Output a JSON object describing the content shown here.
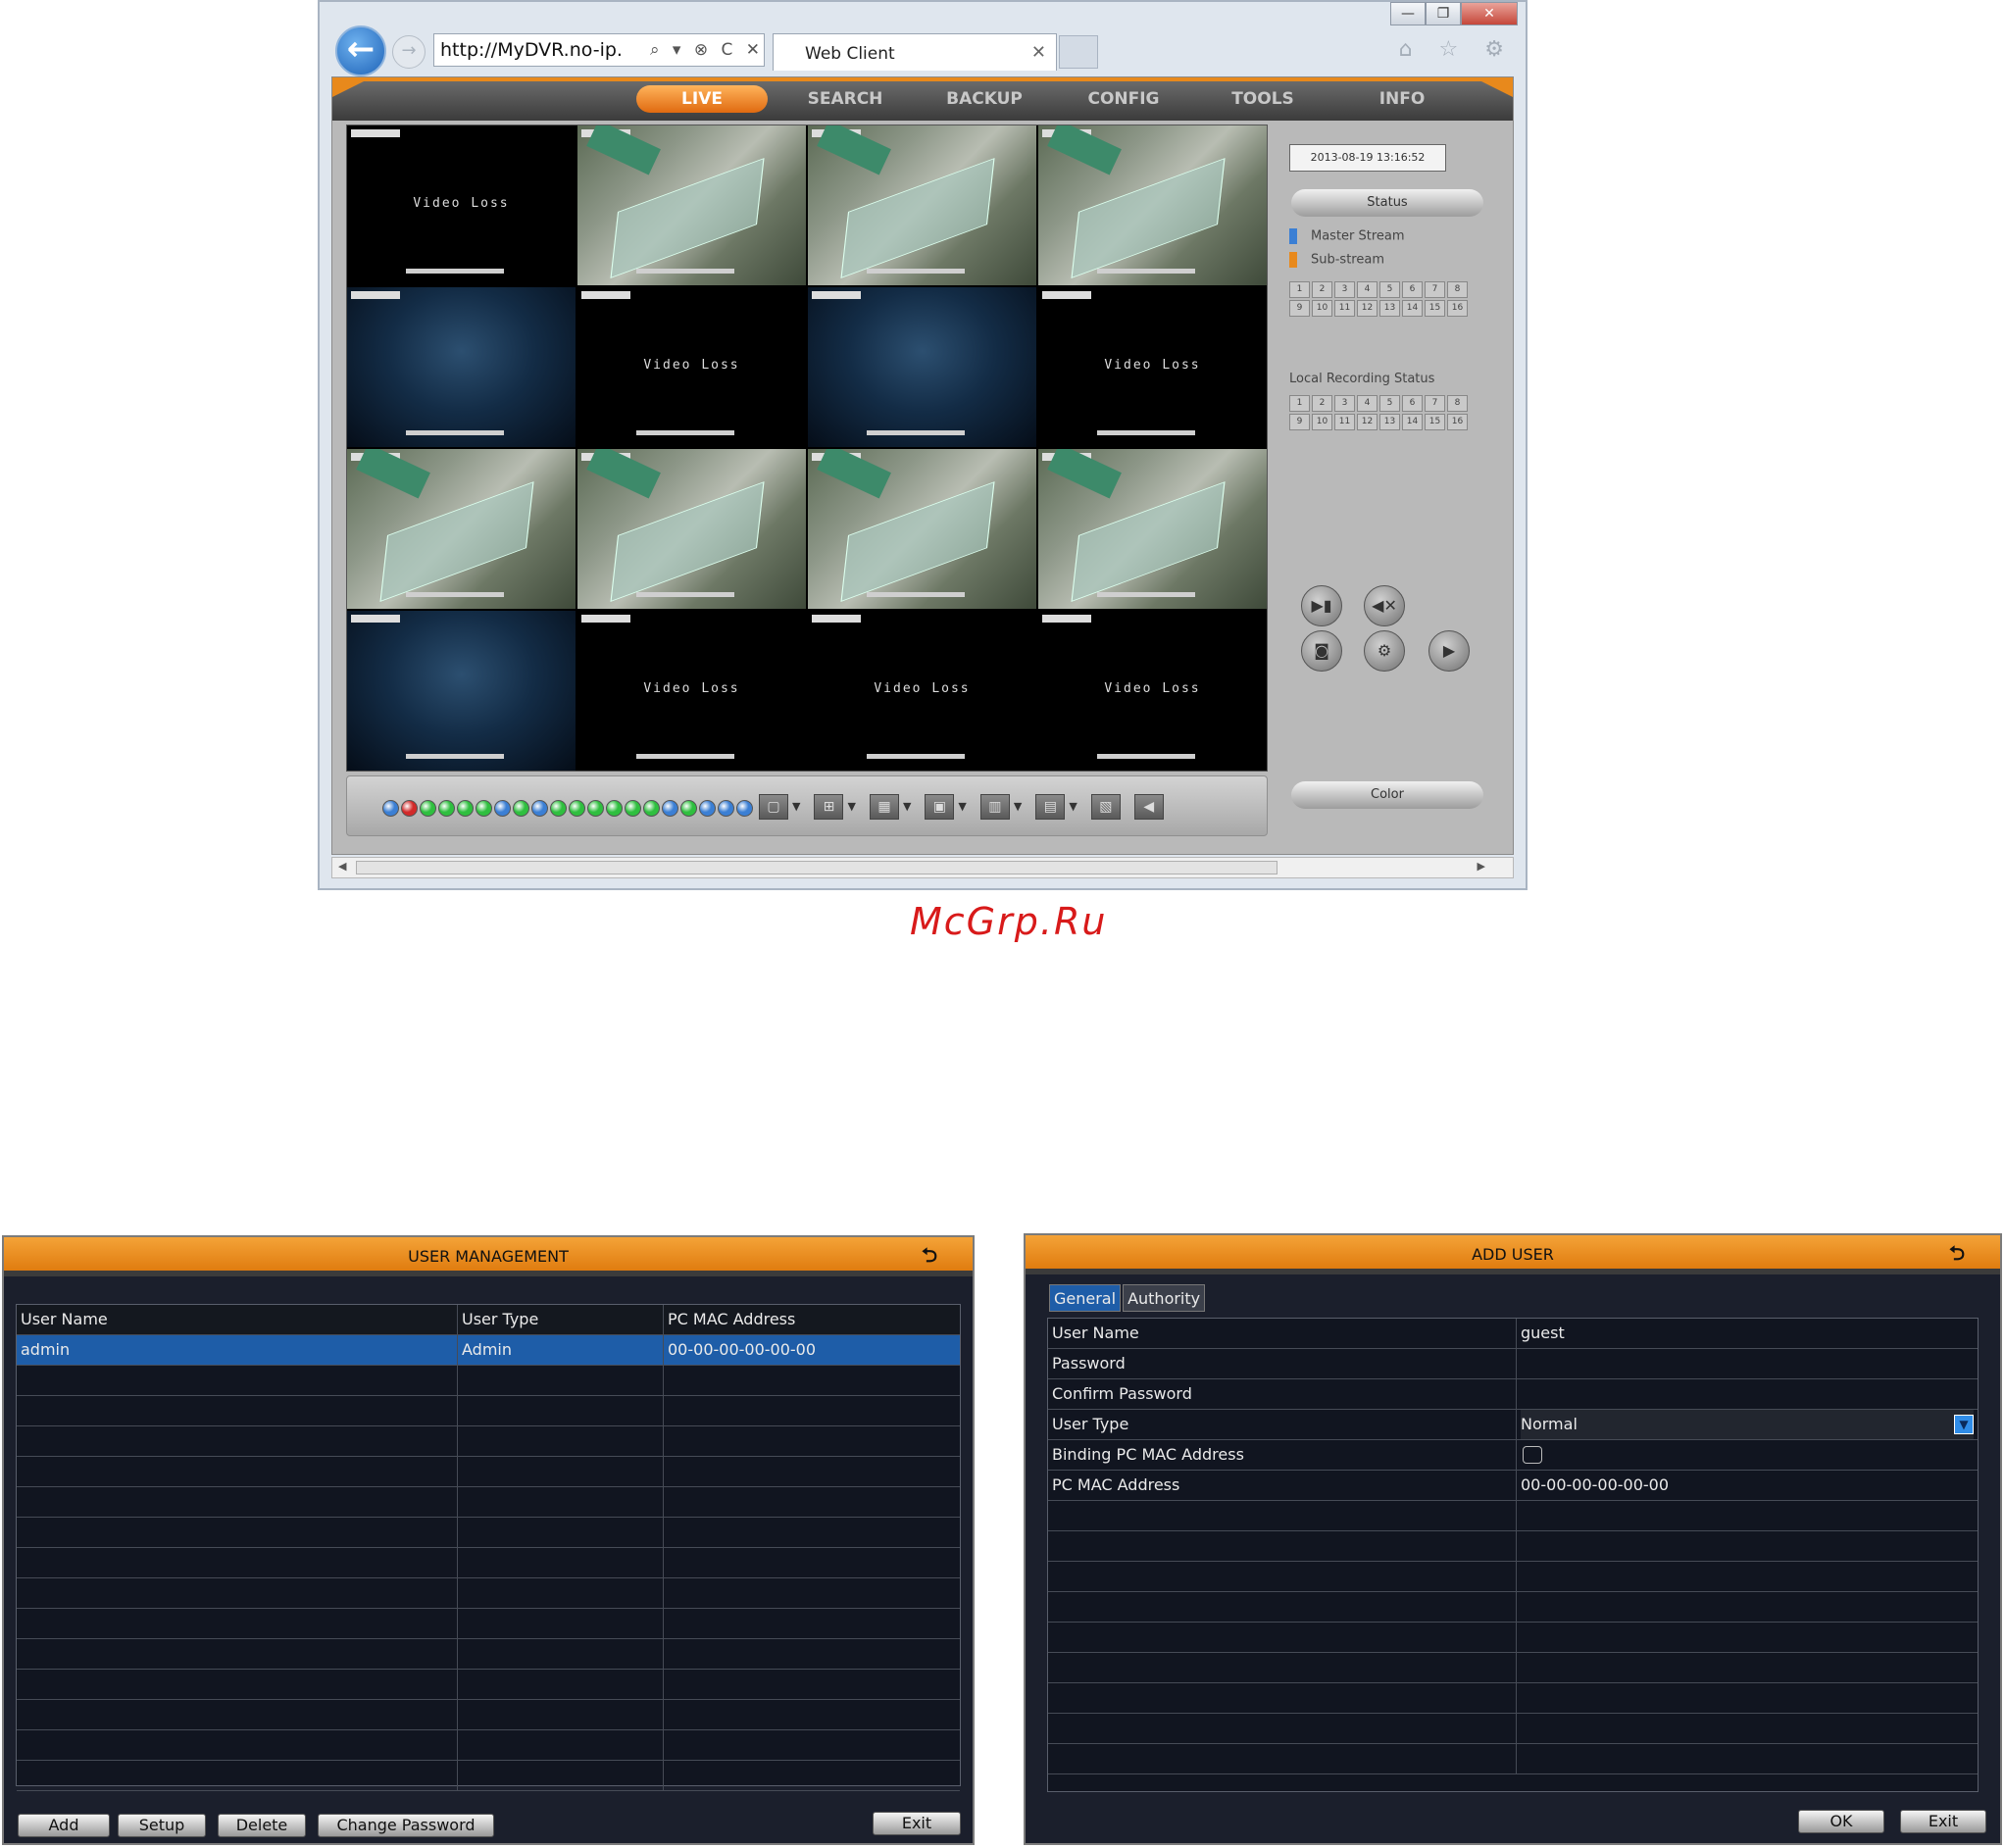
{
  "browser": {
    "url": "http://MyDVR.no-ip.",
    "address_tools": "⌕ ▾ ⊗ C ✕",
    "tab_title": "Web Client",
    "tab_close": "✕",
    "win_minimize": "—",
    "win_restore": "❐",
    "win_close": "✕",
    "toolbar_icons": "⌂ ☆ ⚙"
  },
  "dvr_web": {
    "menu": [
      "LIVE",
      "SEARCH",
      "BACKUP",
      "CONFIG",
      "TOOLS",
      "INFO"
    ],
    "active_menu": "LIVE",
    "video_loss_text": "Video Loss",
    "cells": [
      "loss",
      "cam",
      "cam",
      "cam",
      "sea",
      "loss",
      "sea",
      "loss",
      "cam",
      "cam",
      "cam",
      "cam",
      "sea",
      "loss",
      "loss",
      "loss"
    ],
    "datetime": "2013-08-19 13:16:52",
    "status_button": "Status",
    "legend_master": "Master Stream",
    "legend_sub": "Sub-stream",
    "stream_channels": [
      "1",
      "2",
      "3",
      "4",
      "5",
      "6",
      "7",
      "8",
      "9",
      "10",
      "11",
      "12",
      "13",
      "14",
      "15",
      "16"
    ],
    "local_recording_title": "Local Recording Status",
    "rec_channels": [
      "1",
      "2",
      "3",
      "4",
      "5",
      "6",
      "7",
      "8",
      "9",
      "10",
      "11",
      "12",
      "13",
      "14",
      "15",
      "16"
    ],
    "color_button": "Color",
    "dot_colors": [
      "#3b7fd4",
      "#d22a2a",
      "#2fbf3f",
      "#2fbf3f",
      "#2fbf3f",
      "#2fbf3f",
      "#3b7fd4",
      "#2fbf3f",
      "#3b7fd4",
      "#2fbf3f",
      "#2fbf3f",
      "#2fbf3f",
      "#2fbf3f",
      "#2fbf3f",
      "#2fbf3f",
      "#3b7fd4",
      "#2fbf3f",
      "#3b7fd4",
      "#3b7fd4",
      "#3b7fd4"
    ],
    "accent": "#e8891c"
  },
  "watermark": "McGrp.Ru",
  "user_management": {
    "title": "USER MANAGEMENT",
    "back_icon": "⮌",
    "columns": [
      "User Name",
      "User Type",
      "PC MAC Address"
    ],
    "rows": [
      {
        "name": "admin",
        "type": "Admin",
        "mac": "00-00-00-00-00-00"
      }
    ],
    "buttons": {
      "add": "Add",
      "setup": "Setup",
      "delete": "Delete",
      "change_password": "Change Password",
      "exit": "Exit"
    }
  },
  "add_user": {
    "title": "ADD USER",
    "back_icon": "⮌",
    "tabs": [
      "General",
      "Authority"
    ],
    "fields": {
      "user_name_label": "User Name",
      "user_name_value": "guest",
      "password_label": "Password",
      "confirm_password_label": "Confirm Password",
      "user_type_label": "User Type",
      "user_type_value": "Normal",
      "binding_label": "Binding PC MAC Address",
      "mac_label": "PC MAC Address",
      "mac_value": "00-00-00-00-00-00"
    },
    "buttons": {
      "ok": "OK",
      "exit": "Exit"
    }
  }
}
